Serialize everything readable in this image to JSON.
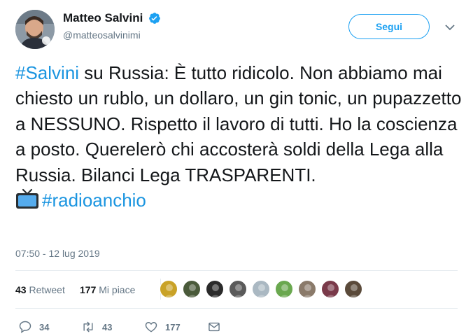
{
  "user": {
    "display_name": "Matteo Salvini",
    "handle": "@matteosalvinimi",
    "verified": true
  },
  "follow_label": "Segui",
  "tweet": {
    "hashtag1": "#Salvini",
    "text": " su Russia: È tutto ridicolo. Non abbiamo mai chiesto un rublo, un dollaro, un gin tonic, un pupazzetto a NESSUNO. Rispetto il lavoro di tutti. Ho la coscienza a posto. Querelerò chi accosterà soldi della Lega alla Russia. Bilanci Lega TRASPARENTI.",
    "emoji": "tv-emoji",
    "hashtag2": "#radioanchio"
  },
  "timestamp": "07:50 - 12 lug 2019",
  "stats": {
    "retweets_count": "43",
    "retweets_label": "Retweet",
    "likes_count": "177",
    "likes_label": "Mi piace"
  },
  "likers": [
    {
      "name": "liker-avatar-1",
      "color": "#c9a227"
    },
    {
      "name": "liker-avatar-2",
      "color": "#4a5a3a"
    },
    {
      "name": "liker-avatar-3",
      "color": "#2a2a2a"
    },
    {
      "name": "liker-avatar-4",
      "color": "#5a5a5a"
    },
    {
      "name": "liker-avatar-5",
      "color": "#aab8c2"
    },
    {
      "name": "liker-avatar-6",
      "color": "#6aa84f"
    },
    {
      "name": "liker-avatar-7",
      "color": "#8a7a6a"
    },
    {
      "name": "liker-avatar-8",
      "color": "#7a3a4a"
    },
    {
      "name": "liker-avatar-9",
      "color": "#5a4a3a"
    }
  ],
  "actions": {
    "replies": "34",
    "retweets": "43",
    "likes": "177"
  },
  "colors": {
    "accent": "#1da1f2",
    "link": "#1b95e0",
    "muted": "#657786"
  }
}
